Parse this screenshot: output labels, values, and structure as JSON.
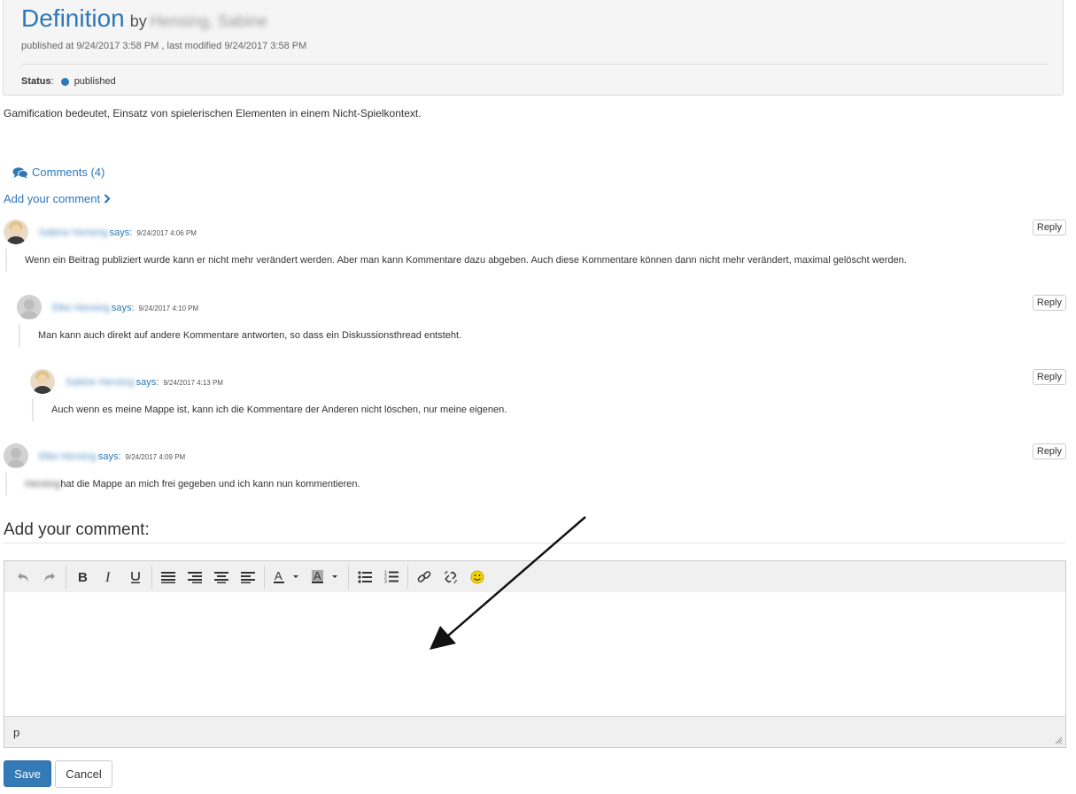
{
  "entry": {
    "title": "Definition",
    "by_label": "by",
    "author": "Hensing, Sabine",
    "published_info": "published at 9/24/2017 3:58 PM , last modified 9/24/2017 3:58 PM",
    "status_label": "Status",
    "status_value": "published",
    "status_color": "#2e78b7",
    "body": "Gamification bedeutet, Einsatz von spielerischen Elementen in einem Nicht-Spielkontext."
  },
  "comments_section": {
    "comments_link": "Comments (4)",
    "add_comment_link": "Add your comment"
  },
  "comments": [
    {
      "author": "Sabine Hensing",
      "says": "says:",
      "date": "9/24/2017 4:06 PM",
      "body": "Wenn ein Beitrag publiziert wurde kann er nicht mehr verändert werden. Aber man kann Kommentare dazu abgeben. Auch diese Kommentare können dann nicht mehr verändert, maximal gelöscht werden.",
      "reply_label": "Reply",
      "avatar": "photo"
    },
    {
      "author": "Elke Hensing",
      "says": "says:",
      "date": "9/24/2017 4:10 PM",
      "body": "Man kann auch direkt auf andere Kommentare antworten, so dass ein Diskussionsthread entsteht.",
      "reply_label": "Reply",
      "avatar": "placeholder"
    },
    {
      "author": "Sabine Hensing",
      "says": "says:",
      "date": "9/24/2017 4:13 PM",
      "body": "Auch wenn es meine Mappe ist, kann ich die Kommentare der Anderen nicht löschen, nur meine eigenen.",
      "reply_label": "Reply",
      "avatar": "photo"
    },
    {
      "author": "Elke Hensing",
      "says": "says:",
      "date": "9/24/2017 4:09 PM",
      "body_prefix": "Hensing",
      "body": "hat die Mappe an mich frei gegeben und ich kann nun kommentieren.",
      "reply_label": "Reply",
      "avatar": "placeholder"
    }
  ],
  "add_comment": {
    "heading": "Add your comment:",
    "toolbar_icons": [
      "undo-icon",
      "redo-icon",
      "bold-icon",
      "italic-icon",
      "underline-icon",
      "align-justify-icon",
      "align-right-icon",
      "align-center-icon",
      "align-left-icon",
      "text-color-icon",
      "background-color-icon",
      "bullet-list-icon",
      "numbered-list-icon",
      "link-icon",
      "unlink-icon",
      "emoticons-icon"
    ],
    "status_path": "p",
    "save_label": "Save",
    "cancel_label": "Cancel"
  },
  "colors": {
    "accent": "#337ab7",
    "link": "#2e78b7",
    "panel_bg": "#f5f5f5"
  }
}
